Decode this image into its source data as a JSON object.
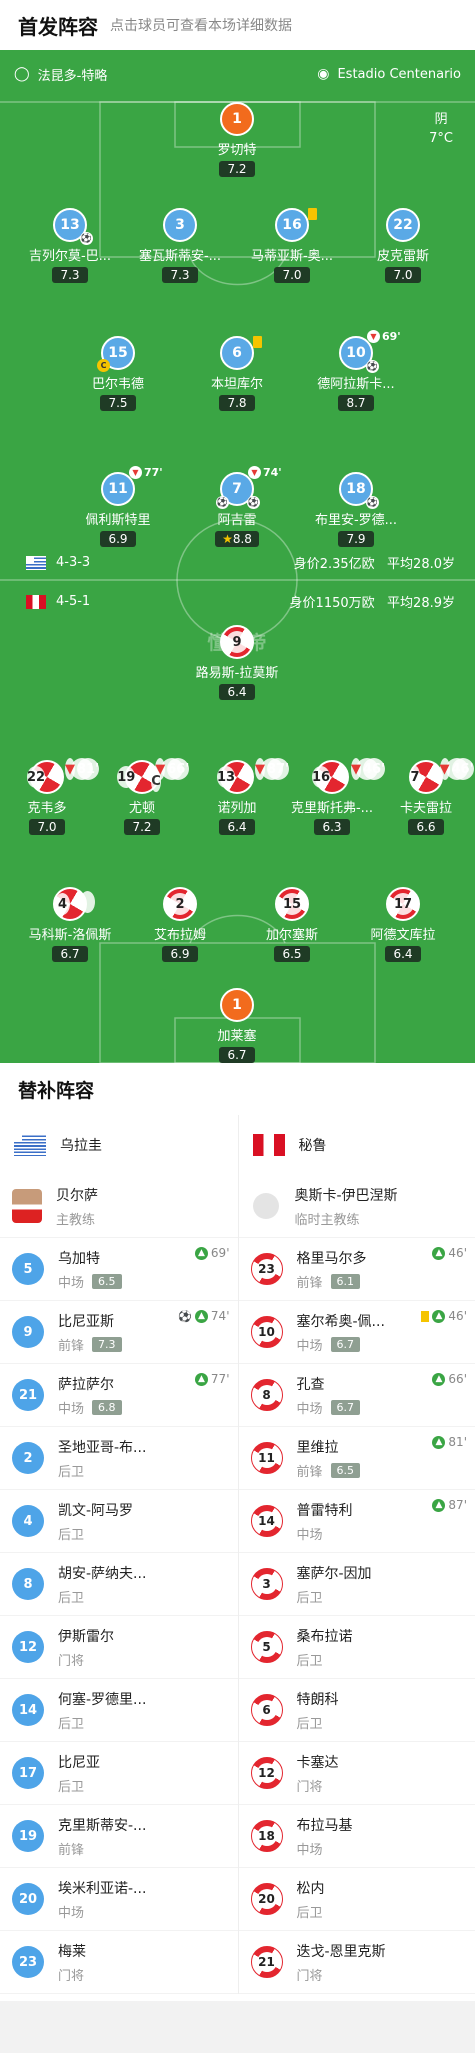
{
  "header": {
    "title": "首发阵容",
    "subtitle": "点击球员可查看本场详细数据"
  },
  "pitch_info": {
    "referee": "法昆多-特略",
    "stadium": "Estadio Centenario",
    "weather": "阴",
    "temperature": "7°C",
    "center_logo": "懂球帝"
  },
  "home": {
    "formation": "4-3-3",
    "value_text": "身价2.35亿欧",
    "age_text": "平均28.0岁",
    "players": [
      {
        "num": "1",
        "name": "罗切特",
        "rating": "7.2",
        "gk": true
      },
      {
        "num": "13",
        "name": "吉列尔莫-巴...",
        "rating": "7.3"
      },
      {
        "num": "3",
        "name": "塞瓦斯蒂安-...",
        "rating": "7.3"
      },
      {
        "num": "16",
        "name": "马蒂亚斯-奥...",
        "rating": "7.0"
      },
      {
        "num": "22",
        "name": "皮克雷斯",
        "rating": "7.0"
      },
      {
        "num": "15",
        "name": "巴尔韦德",
        "rating": "7.5"
      },
      {
        "num": "6",
        "name": "本坦库尔",
        "rating": "7.8"
      },
      {
        "num": "10",
        "name": "德阿拉斯卡...",
        "rating": "8.7",
        "sub_min": "69'"
      },
      {
        "num": "11",
        "name": "佩利斯特里",
        "rating": "6.9",
        "sub_min": "77'"
      },
      {
        "num": "7",
        "name": "阿吉雷",
        "rating": "8.8",
        "sub_min": "74'"
      },
      {
        "num": "18",
        "name": "布里安-罗德...",
        "rating": "7.9"
      }
    ]
  },
  "away": {
    "formation": "4-5-1",
    "value_text": "身价1150万欧",
    "age_text": "平均28.9岁",
    "players": [
      {
        "num": "9",
        "name": "路易斯-拉莫斯",
        "rating": "6.4"
      },
      {
        "num": "22",
        "name": "克韦多",
        "rating": "7.0",
        "sub_min": "81'"
      },
      {
        "num": "19",
        "name": "尤顿",
        "rating": "7.2",
        "sub_min": "66'"
      },
      {
        "num": "13",
        "name": "诺列加",
        "rating": "6.4",
        "sub_min": "87'"
      },
      {
        "num": "16",
        "name": "克里斯托弗-...",
        "rating": "6.3",
        "sub_min": "46'"
      },
      {
        "num": "7",
        "name": "卡夫雷拉",
        "rating": "6.6",
        "sub_min": "46'"
      },
      {
        "num": "4",
        "name": "马科斯-洛佩斯",
        "rating": "6.7"
      },
      {
        "num": "2",
        "name": "艾布拉姆",
        "rating": "6.9"
      },
      {
        "num": "15",
        "name": "加尔塞斯",
        "rating": "6.5"
      },
      {
        "num": "17",
        "name": "阿德文库拉",
        "rating": "6.4"
      },
      {
        "num": "1",
        "name": "加莱塞",
        "rating": "6.7",
        "gk": true
      }
    ]
  },
  "subs": {
    "title": "替补阵容",
    "home_team": "乌拉圭",
    "away_team": "秘鲁",
    "home_coach": {
      "name": "贝尔萨",
      "role": "主教练"
    },
    "away_coach": {
      "name": "奥斯卡-伊巴涅斯",
      "role": "临时主教练"
    },
    "home": [
      {
        "num": "5",
        "name": "乌加特",
        "pos": "中场",
        "rating": "6.5",
        "event": "69'"
      },
      {
        "num": "9",
        "name": "比尼亚斯",
        "pos": "前锋",
        "rating": "7.3",
        "event": "74'",
        "ball": true
      },
      {
        "num": "21",
        "name": "萨拉萨尔",
        "pos": "中场",
        "rating": "6.8",
        "event": "77'"
      },
      {
        "num": "2",
        "name": "圣地亚哥-布...",
        "pos": "后卫"
      },
      {
        "num": "4",
        "name": "凯文-阿马罗",
        "pos": "后卫"
      },
      {
        "num": "8",
        "name": "胡安-萨纳夫...",
        "pos": "后卫"
      },
      {
        "num": "12",
        "name": "伊斯雷尔",
        "pos": "门将"
      },
      {
        "num": "14",
        "name": "何塞-罗德里...",
        "pos": "后卫"
      },
      {
        "num": "17",
        "name": "比尼亚",
        "pos": "后卫"
      },
      {
        "num": "19",
        "name": "克里斯蒂安-...",
        "pos": "前锋"
      },
      {
        "num": "20",
        "name": "埃米利亚诺-...",
        "pos": "中场"
      },
      {
        "num": "23",
        "name": "梅莱",
        "pos": "门将"
      }
    ],
    "away": [
      {
        "num": "23",
        "name": "格里马尔多",
        "pos": "前锋",
        "rating": "6.1",
        "event": "46'"
      },
      {
        "num": "10",
        "name": "塞尔希奥-佩...",
        "pos": "中场",
        "rating": "6.7",
        "event": "46'",
        "ycard": true
      },
      {
        "num": "8",
        "name": "孔查",
        "pos": "中场",
        "rating": "6.7",
        "event": "66'"
      },
      {
        "num": "11",
        "name": "里维拉",
        "pos": "前锋",
        "rating": "6.5",
        "event": "81'"
      },
      {
        "num": "14",
        "name": "普雷特利",
        "pos": "中场",
        "event": "87'"
      },
      {
        "num": "3",
        "name": "塞萨尔-因加",
        "pos": "后卫"
      },
      {
        "num": "5",
        "name": "桑布拉诺",
        "pos": "后卫"
      },
      {
        "num": "6",
        "name": "特朗科",
        "pos": "后卫"
      },
      {
        "num": "12",
        "name": "卡塞达",
        "pos": "门将"
      },
      {
        "num": "18",
        "name": "布拉马基",
        "pos": "中场"
      },
      {
        "num": "20",
        "name": "松内",
        "pos": "后卫"
      },
      {
        "num": "21",
        "name": "迭戈-恩里克斯",
        "pos": "门将"
      }
    ]
  }
}
